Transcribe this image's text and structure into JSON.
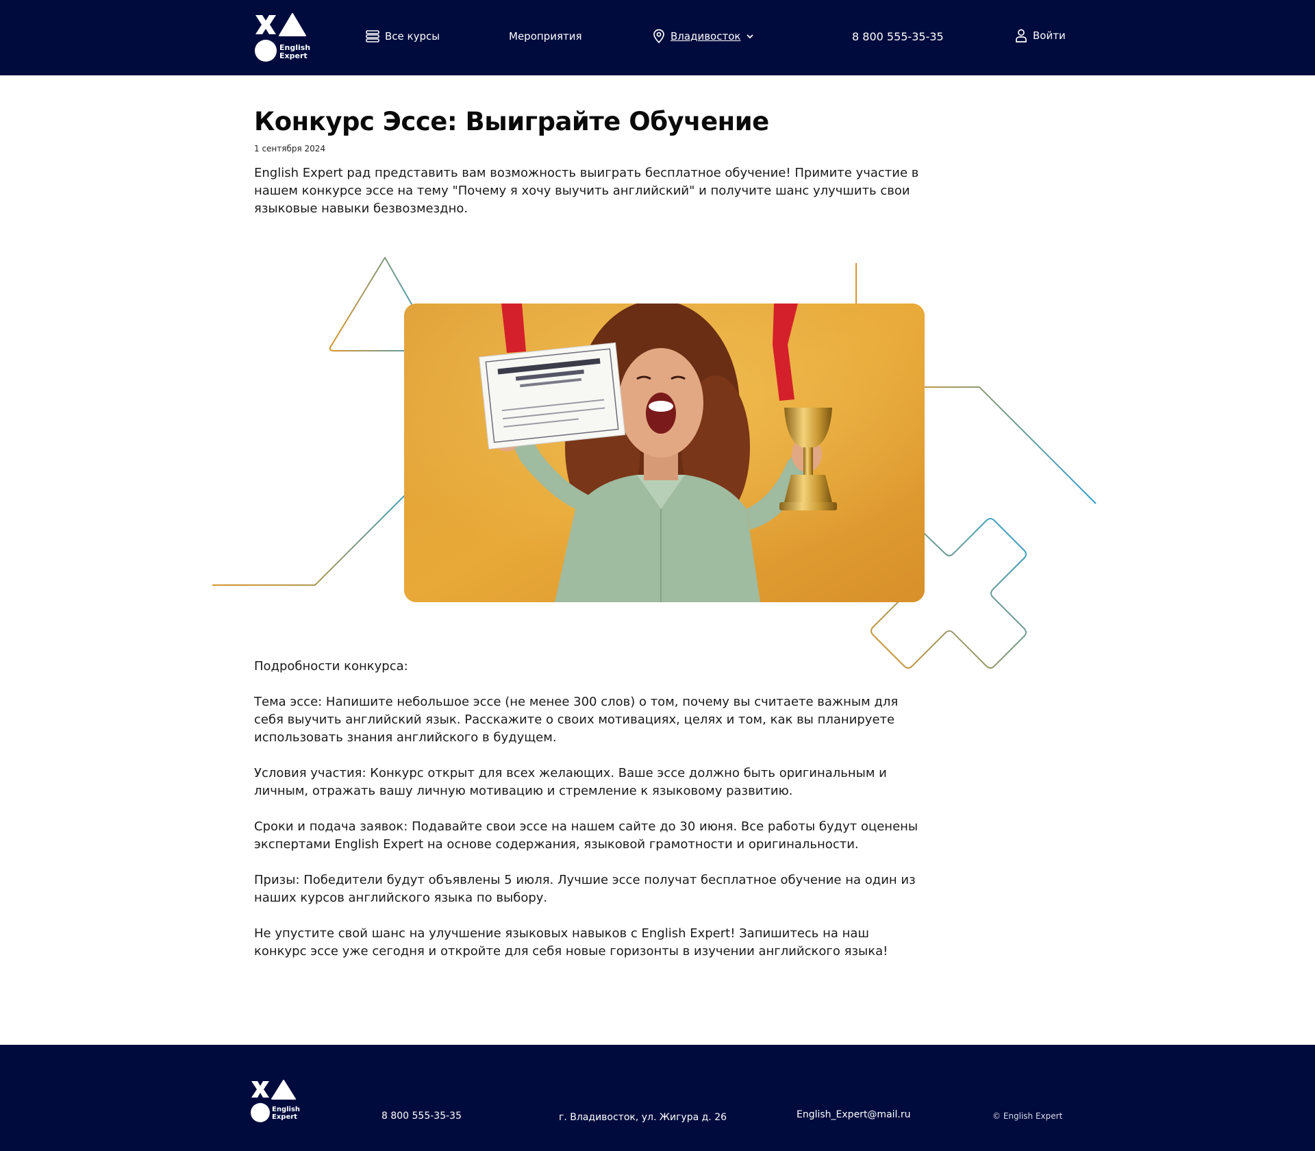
{
  "header": {
    "logo_text_1": "English",
    "logo_text_2": "Expert",
    "nav_courses": "Все курсы",
    "nav_events": "Мероприятия",
    "city": "Владивосток",
    "phone": "8 800 555-35-35",
    "login": "Войти"
  },
  "article": {
    "title": "Конкурс Эссе: Выиграйте Обучение",
    "date": "1 сентября 2024",
    "intro": "English Expert рад представить вам возможность выиграть бесплатное обучение! Примите участие в нашем конкурсе эссе на тему \"Почему я хочу выучить английский\" и получите шанс улучшить свои языковые навыки безвозмездно.",
    "details_heading": "Подробности конкурса:",
    "topic": "Тема эссе: Напишите небольшое эссе (не менее 300 слов) о том, почему вы считаете важным для себя выучить английский язык. Расскажите о своих мотивациях, целях и том, как вы планируете использовать знания английского в будущем.",
    "conditions": "Условия участия: Конкурс открыт для всех желающих. Ваше эссе должно быть оригинальным и личным, отражать вашу личную мотивацию и стремление к языковому развитию.",
    "deadline": "Сроки и подача заявок: Подавайте свои эссе на нашем сайте до 30 июня. Все работы будут оценены экспертами English Expert на основе содержания, языковой грамотности и оригинальности.",
    "prizes": "Призы: Победители будут объявлены 5 июля. Лучшие эссе получат бесплатное обучение на один из наших курсов английского языка по выбору.",
    "closing": "Не упустите свой шанс на улучшение языковых навыков с English Expert! Запишитесь на наш конкурс эссе уже сегодня и откройте для себя новые горизонты в изучении английского языка!"
  },
  "footer": {
    "logo_text_1": "English",
    "logo_text_2": "Expert",
    "phone": "8 800 555-35-35",
    "address": "г. Владивосток, ул. Жигура д. 26",
    "email": "English_Expert@mail.ru",
    "copyright": "© English Expert"
  },
  "colors": {
    "navy": "#000b3d",
    "accent_orange": "#d9952a",
    "accent_blue": "#2a9fd0"
  },
  "icons": [
    "burger-icon",
    "location-pin-icon",
    "chevron-down-icon",
    "user-icon"
  ]
}
